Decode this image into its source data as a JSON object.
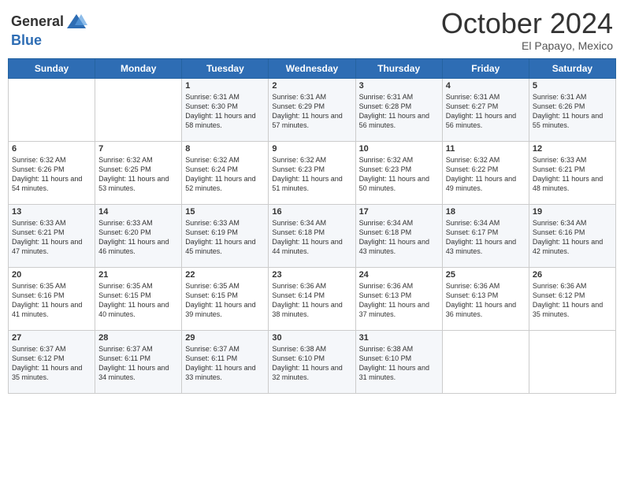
{
  "header": {
    "logo_general": "General",
    "logo_blue": "Blue",
    "month": "October 2024",
    "location": "El Papayo, Mexico"
  },
  "days_of_week": [
    "Sunday",
    "Monday",
    "Tuesday",
    "Wednesday",
    "Thursday",
    "Friday",
    "Saturday"
  ],
  "weeks": [
    [
      {
        "day": "",
        "sunrise": "",
        "sunset": "",
        "daylight": ""
      },
      {
        "day": "",
        "sunrise": "",
        "sunset": "",
        "daylight": ""
      },
      {
        "day": "1",
        "sunrise": "Sunrise: 6:31 AM",
        "sunset": "Sunset: 6:30 PM",
        "daylight": "Daylight: 11 hours and 58 minutes."
      },
      {
        "day": "2",
        "sunrise": "Sunrise: 6:31 AM",
        "sunset": "Sunset: 6:29 PM",
        "daylight": "Daylight: 11 hours and 57 minutes."
      },
      {
        "day": "3",
        "sunrise": "Sunrise: 6:31 AM",
        "sunset": "Sunset: 6:28 PM",
        "daylight": "Daylight: 11 hours and 56 minutes."
      },
      {
        "day": "4",
        "sunrise": "Sunrise: 6:31 AM",
        "sunset": "Sunset: 6:27 PM",
        "daylight": "Daylight: 11 hours and 56 minutes."
      },
      {
        "day": "5",
        "sunrise": "Sunrise: 6:31 AM",
        "sunset": "Sunset: 6:26 PM",
        "daylight": "Daylight: 11 hours and 55 minutes."
      }
    ],
    [
      {
        "day": "6",
        "sunrise": "Sunrise: 6:32 AM",
        "sunset": "Sunset: 6:26 PM",
        "daylight": "Daylight: 11 hours and 54 minutes."
      },
      {
        "day": "7",
        "sunrise": "Sunrise: 6:32 AM",
        "sunset": "Sunset: 6:25 PM",
        "daylight": "Daylight: 11 hours and 53 minutes."
      },
      {
        "day": "8",
        "sunrise": "Sunrise: 6:32 AM",
        "sunset": "Sunset: 6:24 PM",
        "daylight": "Daylight: 11 hours and 52 minutes."
      },
      {
        "day": "9",
        "sunrise": "Sunrise: 6:32 AM",
        "sunset": "Sunset: 6:23 PM",
        "daylight": "Daylight: 11 hours and 51 minutes."
      },
      {
        "day": "10",
        "sunrise": "Sunrise: 6:32 AM",
        "sunset": "Sunset: 6:23 PM",
        "daylight": "Daylight: 11 hours and 50 minutes."
      },
      {
        "day": "11",
        "sunrise": "Sunrise: 6:32 AM",
        "sunset": "Sunset: 6:22 PM",
        "daylight": "Daylight: 11 hours and 49 minutes."
      },
      {
        "day": "12",
        "sunrise": "Sunrise: 6:33 AM",
        "sunset": "Sunset: 6:21 PM",
        "daylight": "Daylight: 11 hours and 48 minutes."
      }
    ],
    [
      {
        "day": "13",
        "sunrise": "Sunrise: 6:33 AM",
        "sunset": "Sunset: 6:21 PM",
        "daylight": "Daylight: 11 hours and 47 minutes."
      },
      {
        "day": "14",
        "sunrise": "Sunrise: 6:33 AM",
        "sunset": "Sunset: 6:20 PM",
        "daylight": "Daylight: 11 hours and 46 minutes."
      },
      {
        "day": "15",
        "sunrise": "Sunrise: 6:33 AM",
        "sunset": "Sunset: 6:19 PM",
        "daylight": "Daylight: 11 hours and 45 minutes."
      },
      {
        "day": "16",
        "sunrise": "Sunrise: 6:34 AM",
        "sunset": "Sunset: 6:18 PM",
        "daylight": "Daylight: 11 hours and 44 minutes."
      },
      {
        "day": "17",
        "sunrise": "Sunrise: 6:34 AM",
        "sunset": "Sunset: 6:18 PM",
        "daylight": "Daylight: 11 hours and 43 minutes."
      },
      {
        "day": "18",
        "sunrise": "Sunrise: 6:34 AM",
        "sunset": "Sunset: 6:17 PM",
        "daylight": "Daylight: 11 hours and 43 minutes."
      },
      {
        "day": "19",
        "sunrise": "Sunrise: 6:34 AM",
        "sunset": "Sunset: 6:16 PM",
        "daylight": "Daylight: 11 hours and 42 minutes."
      }
    ],
    [
      {
        "day": "20",
        "sunrise": "Sunrise: 6:35 AM",
        "sunset": "Sunset: 6:16 PM",
        "daylight": "Daylight: 11 hours and 41 minutes."
      },
      {
        "day": "21",
        "sunrise": "Sunrise: 6:35 AM",
        "sunset": "Sunset: 6:15 PM",
        "daylight": "Daylight: 11 hours and 40 minutes."
      },
      {
        "day": "22",
        "sunrise": "Sunrise: 6:35 AM",
        "sunset": "Sunset: 6:15 PM",
        "daylight": "Daylight: 11 hours and 39 minutes."
      },
      {
        "day": "23",
        "sunrise": "Sunrise: 6:36 AM",
        "sunset": "Sunset: 6:14 PM",
        "daylight": "Daylight: 11 hours and 38 minutes."
      },
      {
        "day": "24",
        "sunrise": "Sunrise: 6:36 AM",
        "sunset": "Sunset: 6:13 PM",
        "daylight": "Daylight: 11 hours and 37 minutes."
      },
      {
        "day": "25",
        "sunrise": "Sunrise: 6:36 AM",
        "sunset": "Sunset: 6:13 PM",
        "daylight": "Daylight: 11 hours and 36 minutes."
      },
      {
        "day": "26",
        "sunrise": "Sunrise: 6:36 AM",
        "sunset": "Sunset: 6:12 PM",
        "daylight": "Daylight: 11 hours and 35 minutes."
      }
    ],
    [
      {
        "day": "27",
        "sunrise": "Sunrise: 6:37 AM",
        "sunset": "Sunset: 6:12 PM",
        "daylight": "Daylight: 11 hours and 35 minutes."
      },
      {
        "day": "28",
        "sunrise": "Sunrise: 6:37 AM",
        "sunset": "Sunset: 6:11 PM",
        "daylight": "Daylight: 11 hours and 34 minutes."
      },
      {
        "day": "29",
        "sunrise": "Sunrise: 6:37 AM",
        "sunset": "Sunset: 6:11 PM",
        "daylight": "Daylight: 11 hours and 33 minutes."
      },
      {
        "day": "30",
        "sunrise": "Sunrise: 6:38 AM",
        "sunset": "Sunset: 6:10 PM",
        "daylight": "Daylight: 11 hours and 32 minutes."
      },
      {
        "day": "31",
        "sunrise": "Sunrise: 6:38 AM",
        "sunset": "Sunset: 6:10 PM",
        "daylight": "Daylight: 11 hours and 31 minutes."
      },
      {
        "day": "",
        "sunrise": "",
        "sunset": "",
        "daylight": ""
      },
      {
        "day": "",
        "sunrise": "",
        "sunset": "",
        "daylight": ""
      }
    ]
  ]
}
